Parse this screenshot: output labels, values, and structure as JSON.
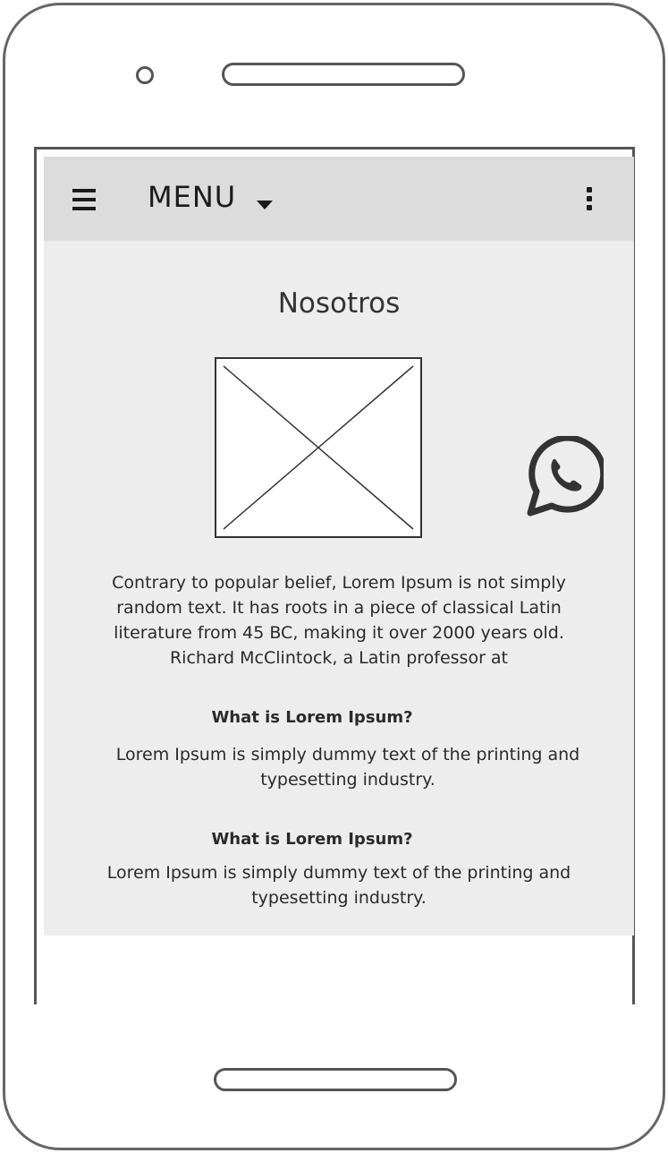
{
  "topbar": {
    "menu_label": "MENU",
    "icons": {
      "left": "hamburger-icon",
      "caret": "caret-down-icon",
      "right": "more-vertical-icon"
    }
  },
  "main": {
    "title": "Nosotros",
    "image_icon": "image-placeholder-icon",
    "contact_icon": "whatsapp-icon",
    "intro": "Contrary to popular belief, Lorem Ipsum is not simply random text. It has roots in a piece of classical Latin literature from 45 BC, making it over 2000 years old. Richard McClintock, a Latin professor at",
    "sections": [
      {
        "heading": "What is Lorem Ipsum?",
        "body": "Lorem Ipsum is simply dummy text of the printing and typesetting industry."
      },
      {
        "heading": "What is Lorem Ipsum?",
        "body": "Lorem Ipsum is simply dummy text of the printing and typesetting industry."
      }
    ]
  },
  "colors": {
    "frame": "#666666",
    "topbar_bg": "#dcdcdc",
    "content_bg": "#ededed",
    "text": "#2a2a2a"
  }
}
